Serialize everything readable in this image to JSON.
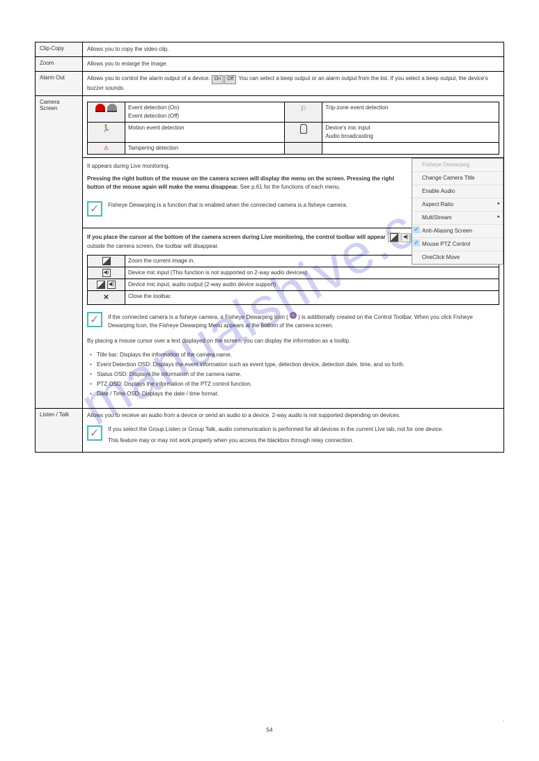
{
  "watermark": "manualshive.com",
  "rows": {
    "clip_copy": {
      "label": "Clip-Copy",
      "text": "Allows you to copy the video clip."
    },
    "zoom": {
      "label": "Zoom",
      "text": "Allows you to enlarge the image."
    },
    "alarm_out": {
      "label": "Alarm Out",
      "text_before": "Allows you to control the alarm output of a device. ",
      "text_after": " You can select a beep output or an alarm output from the list. If you select a beep output, the device's buzzer sounds.",
      "btn_on": "On",
      "btn_off": "Off"
    },
    "camera_screen": {
      "label": "Camera Screen",
      "event_table": {
        "event_on": "Event detection (On)",
        "event_off": "Event detection (Off)",
        "motion_det": "Motion event detection",
        "trip_zone": "Trip-zone event detection",
        "mic_input": "Device's mic input",
        "audio_broadcast": "Audio broadcasting",
        "tampering": "Tampering detection"
      },
      "block1": {
        "p1": "It appears during Live monitoring.",
        "p2_prefix": "Pressing the right button of the mouse on the camera screen will display the menu on the screen. Pressing the right button of the mouse again will make the menu disappear.",
        "p2_suffix": " See p.61 for the functions of each menu.",
        "note": "Fisheye Dewarping is a function that is enabled when the connected camera is a fisheye camera."
      },
      "menu": {
        "hdr": "Fisheye Dewarping",
        "i1": "Change Camera Title",
        "i2": "Enable Audio",
        "i3": "Aspect Ratio",
        "i4": "MultiStream",
        "i5": "Anti-Aliasing Screen",
        "i6": "Mouse PTZ Control",
        "i7": "OneClick Move"
      },
      "block2": {
        "p1_a": "If you place the cursor at the bottom of the camera screen during Live monitoring, the control toolbar will appear ",
        "p1_b": ". If you move the mouse cursor outside the camera screen, the toolbar will disappear.",
        "tbl": {
          "r1": "Zoom the current image in.",
          "r2": "Device mic input (This function is not supported on 2-way audio devices)",
          "r3": "Device mic input, audio output (2-way audio device support)",
          "r4": "Close the toolbar."
        },
        "note_a": "If the connected camera is a fisheye camera, a Fisheye Dewarping Icon (",
        "note_b": ") is additionally created on the Control Toolbar. When you click Fisheye Dewarping Icon, the Fisheye Dewarping Menu appears at the bottom of the camera screen.",
        "p2": "By placing a mouse cursor over a text displayed on the screen, you can display the information as a tooltip.",
        "bullets": {
          "b1": "Title bar: Displays the information of the camera name.",
          "b2": "Event Detection OSD: Displays the event information such as event type, detection device, detection date, time, and so forth.",
          "b3": "Status OSD: Displays the information of the camera name.",
          "b4": "PTZ OSD: Displays the information of the PTZ control function.",
          "b5": "Date / Time OSD: Displays the date / time format."
        }
      }
    },
    "listen_talk": {
      "label": "Listen / Talk",
      "text": "Allows you to receive an audio from a device or send an audio to a device. 2-way audio is not supported depending on devices.",
      "note1": "If you select the Group Listen or Group Talk, audio communication is performed for all devices in the current Live tab, not for one device.",
      "note2": "This feature may or may not work properly when you access the blackbox through relay connection."
    }
  },
  "footer": {
    "period": ".",
    "page": "54"
  }
}
